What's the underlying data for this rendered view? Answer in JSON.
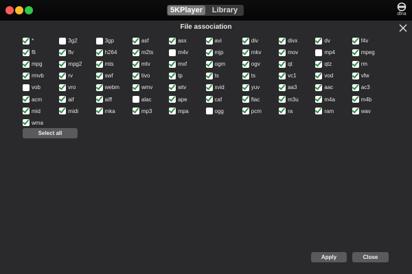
{
  "titlebar": {
    "tabs": [
      {
        "label": "5KPlayer",
        "active": true
      },
      {
        "label": "Library",
        "active": false
      }
    ],
    "dlna_label": "dlna"
  },
  "dialog": {
    "title": "File association",
    "select_all_label": "Select all",
    "apply_label": "Apply",
    "close_label": "Close"
  },
  "file_types": [
    {
      "ext": "*",
      "checked": true
    },
    {
      "ext": "3g2",
      "checked": false
    },
    {
      "ext": "3gp",
      "checked": false
    },
    {
      "ext": "asf",
      "checked": true
    },
    {
      "ext": "asx",
      "checked": true
    },
    {
      "ext": "avi",
      "checked": true
    },
    {
      "ext": "div",
      "checked": true
    },
    {
      "ext": "divx",
      "checked": true
    },
    {
      "ext": "dv",
      "checked": true
    },
    {
      "ext": "f4v",
      "checked": true
    },
    {
      "ext": "fli",
      "checked": true
    },
    {
      "ext": "flv",
      "checked": true
    },
    {
      "ext": "h264",
      "checked": true
    },
    {
      "ext": "m2ts",
      "checked": true
    },
    {
      "ext": "m4v",
      "checked": false
    },
    {
      "ext": "mjp",
      "checked": true
    },
    {
      "ext": "mkv",
      "checked": true
    },
    {
      "ext": "mov",
      "checked": true
    },
    {
      "ext": "mp4",
      "checked": false
    },
    {
      "ext": "mpeg",
      "checked": true
    },
    {
      "ext": "mpg",
      "checked": true
    },
    {
      "ext": "mpg2",
      "checked": true
    },
    {
      "ext": "mts",
      "checked": true
    },
    {
      "ext": "mtv",
      "checked": true
    },
    {
      "ext": "mxf",
      "checked": true
    },
    {
      "ext": "ogm",
      "checked": true
    },
    {
      "ext": "ogv",
      "checked": true
    },
    {
      "ext": "qt",
      "checked": true
    },
    {
      "ext": "qtz",
      "checked": true
    },
    {
      "ext": "rm",
      "checked": true
    },
    {
      "ext": "rmvb",
      "checked": true
    },
    {
      "ext": "rv",
      "checked": true
    },
    {
      "ext": "swf",
      "checked": true
    },
    {
      "ext": "tivo",
      "checked": true
    },
    {
      "ext": "tp",
      "checked": true
    },
    {
      "ext": "ts",
      "checked": true
    },
    {
      "ext": "ts",
      "checked": true
    },
    {
      "ext": "vc1",
      "checked": true
    },
    {
      "ext": "vod",
      "checked": true
    },
    {
      "ext": "vfw",
      "checked": true
    },
    {
      "ext": "vob",
      "checked": false
    },
    {
      "ext": "vro",
      "checked": true
    },
    {
      "ext": "webm",
      "checked": true
    },
    {
      "ext": "wmv",
      "checked": true
    },
    {
      "ext": "wtv",
      "checked": true
    },
    {
      "ext": "xvid",
      "checked": true
    },
    {
      "ext": "yuv",
      "checked": true
    },
    {
      "ext": "aa3",
      "checked": true
    },
    {
      "ext": "aac",
      "checked": true
    },
    {
      "ext": "ac3",
      "checked": true
    },
    {
      "ext": "acm",
      "checked": true
    },
    {
      "ext": "aif",
      "checked": true
    },
    {
      "ext": "aiff",
      "checked": true
    },
    {
      "ext": "alac",
      "checked": false
    },
    {
      "ext": "ape",
      "checked": true
    },
    {
      "ext": "caf",
      "checked": true
    },
    {
      "ext": "flac",
      "checked": true
    },
    {
      "ext": "m3u",
      "checked": true
    },
    {
      "ext": "m4a",
      "checked": true
    },
    {
      "ext": "m4b",
      "checked": true
    },
    {
      "ext": "mid",
      "checked": true
    },
    {
      "ext": "midi",
      "checked": true
    },
    {
      "ext": "mka",
      "checked": true
    },
    {
      "ext": "mp3",
      "checked": true
    },
    {
      "ext": "mpa",
      "checked": true
    },
    {
      "ext": "ogg",
      "checked": false
    },
    {
      "ext": "pcm",
      "checked": true
    },
    {
      "ext": "ra",
      "checked": true
    },
    {
      "ext": "ram",
      "checked": true
    },
    {
      "ext": "wav",
      "checked": true
    },
    {
      "ext": "wma",
      "checked": true
    }
  ],
  "colors": {
    "check_green": "#2e8c45",
    "traffic_red": "#fc5c57",
    "traffic_yellow": "#fdbc2e",
    "traffic_green": "#33c748"
  }
}
